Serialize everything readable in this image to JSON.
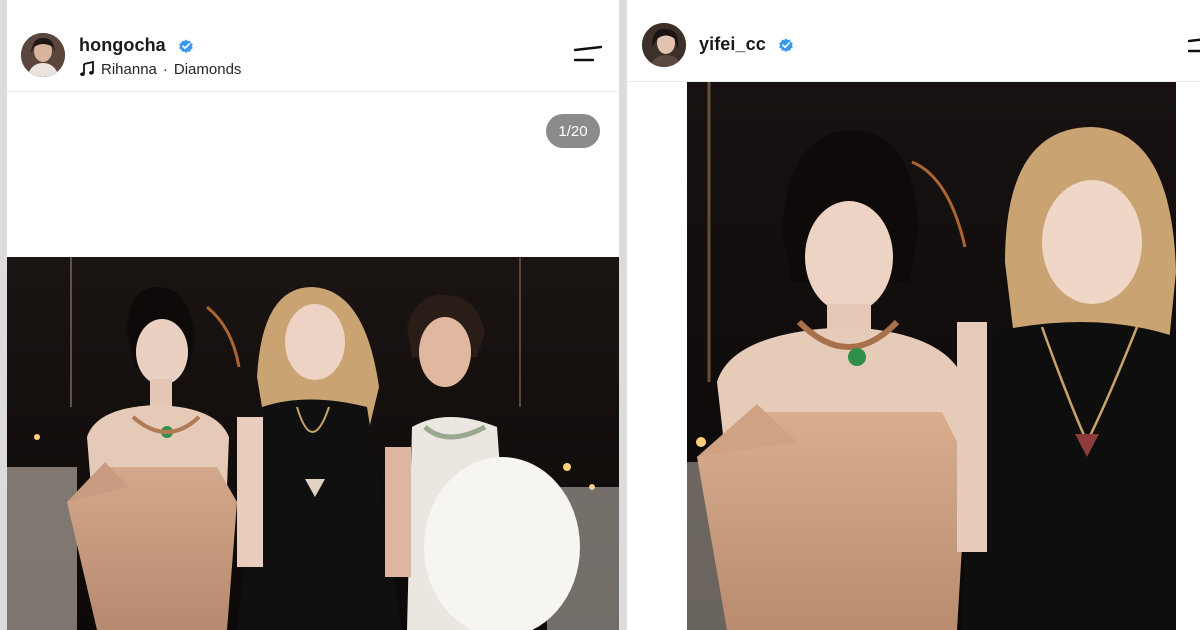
{
  "left_post": {
    "username": "hongocha",
    "verified": true,
    "music": {
      "artist": "Rihanna",
      "separator": "·",
      "song": "Diamonds"
    },
    "slide_counter": "1/20",
    "icons": {
      "verified": "verified-badge-icon",
      "music": "music-note-icon",
      "menu": "menu-icon"
    },
    "image": "event photo of three women posing at a gala dinner"
  },
  "right_post": {
    "username": "yifei_cc",
    "verified": true,
    "icons": {
      "verified": "verified-badge-icon",
      "menu": "menu-icon"
    },
    "image": "event photo of two women posing at a gala dinner"
  },
  "colors": {
    "verified_blue": "#3897f0",
    "counter_bg": "#8b8b8b",
    "background": "#dcdcdc"
  }
}
